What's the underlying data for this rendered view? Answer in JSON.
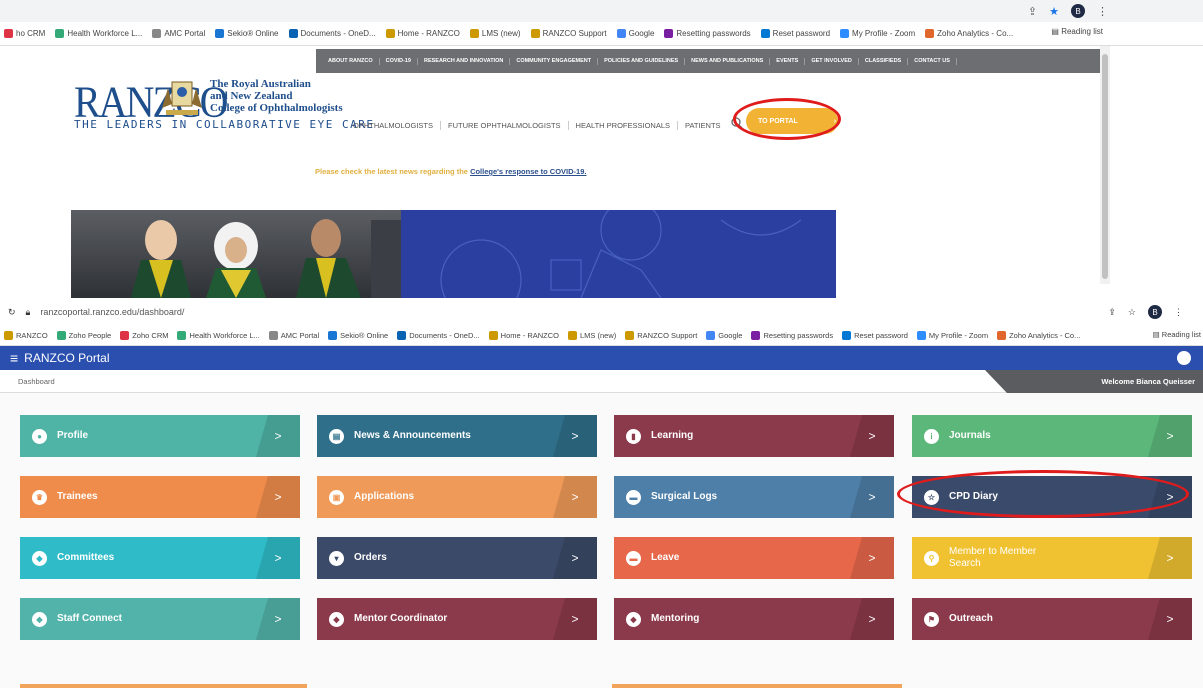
{
  "top": {
    "bookmarks": [
      {
        "label": "ho CRM",
        "color": "#d34"
      },
      {
        "label": "Health Workforce L...",
        "color": "#3a7"
      },
      {
        "label": "AMC Portal",
        "color": "#888"
      },
      {
        "label": "Sekio® Online",
        "color": "#1976d2"
      },
      {
        "label": "Documents - OneD...",
        "color": "#0a62b3"
      },
      {
        "label": "Home - RANZCO",
        "color": "#c90"
      },
      {
        "label": "LMS (new)",
        "color": "#c90"
      },
      {
        "label": "RANZCO Support",
        "color": "#c90"
      },
      {
        "label": "Google",
        "color": "#4285f4"
      },
      {
        "label": "Resetting passwords",
        "color": "#7b1fa2"
      },
      {
        "label": "Reset password",
        "color": "#0078d4"
      },
      {
        "label": "My Profile - Zoom",
        "color": "#2d8cff"
      },
      {
        "label": "Zoho Analytics - Co...",
        "color": "#e0662b"
      }
    ],
    "reading_list": "Reading list",
    "avatar": "B",
    "site_nav": [
      "ABOUT RANZCO",
      "COVID-19",
      "RESEARCH AND INNOVATION",
      "COMMUNITY ENGAGEMENT",
      "POLICIES AND GUIDELINES",
      "NEWS AND PUBLICATIONS",
      "EVENTS",
      "GET INVOLVED",
      "CLASSIFIEDS",
      "CONTACT US"
    ],
    "logo": "RANZCO",
    "college_name": [
      "The Royal Australian",
      "and New Zealand",
      "College of Ophthalmologists"
    ],
    "tagline": "THE LEADERS IN COLLABORATIVE EYE CARE",
    "main_nav": [
      "OPHTHALMOLOGISTS",
      "FUTURE OPHTHALMOLOGISTS",
      "HEALTH PROFESSIONALS",
      "PATIENTS"
    ],
    "portal_button": "TO PORTAL",
    "covid_prefix": "Please check the latest news regarding the ",
    "covid_link": "College's response to COVID-19."
  },
  "bottom": {
    "url": "ranzcoportal.ranzco.edu/dashboard/",
    "bookmarks": [
      {
        "label": "RANZCO",
        "color": "#c90"
      },
      {
        "label": "Zoho People",
        "color": "#3a7"
      },
      {
        "label": "Zoho CRM",
        "color": "#d34"
      },
      {
        "label": "Health Workforce L...",
        "color": "#3a7"
      },
      {
        "label": "AMC Portal",
        "color": "#888"
      },
      {
        "label": "Sekio® Online",
        "color": "#1976d2"
      },
      {
        "label": "Documents - OneD...",
        "color": "#0a62b3"
      },
      {
        "label": "Home - RANZCO",
        "color": "#c90"
      },
      {
        "label": "LMS (new)",
        "color": "#c90"
      },
      {
        "label": "RANZCO Support",
        "color": "#c90"
      },
      {
        "label": "Google",
        "color": "#4285f4"
      },
      {
        "label": "Resetting passwords",
        "color": "#7b1fa2"
      },
      {
        "label": "Reset password",
        "color": "#0078d4"
      },
      {
        "label": "My Profile - Zoom",
        "color": "#2d8cff"
      },
      {
        "label": "Zoho Analytics - Co...",
        "color": "#e0662b"
      }
    ],
    "reading_list": "Reading list",
    "portal_title": "RANZCO Portal",
    "breadcrumb": "Dashboard",
    "welcome": "Welcome Bianca Queisser",
    "arrow": ">",
    "tiles": [
      {
        "label": "Profile",
        "color": "#4fb3a6",
        "icon": "person-icon",
        "glyph": "●"
      },
      {
        "label": "News & Announcements",
        "color": "#2f6f8a",
        "icon": "newspaper-icon",
        "glyph": "▤"
      },
      {
        "label": "Learning",
        "color": "#8b3a4b",
        "icon": "book-icon",
        "glyph": "▮"
      },
      {
        "label": "Journals",
        "color": "#5cb87a",
        "icon": "info-icon",
        "glyph": "i"
      },
      {
        "label": "Trainees",
        "color": "#ef8c4c",
        "icon": "trophy-icon",
        "glyph": "♛"
      },
      {
        "label": "Applications",
        "color": "#ef9a58",
        "icon": "document-icon",
        "glyph": "▣"
      },
      {
        "label": "Surgical Logs",
        "color": "#4e7fa8",
        "icon": "card-icon",
        "glyph": "▬"
      },
      {
        "label": "CPD Diary",
        "color": "#3a4a6b",
        "icon": "star-icon",
        "glyph": "☆"
      },
      {
        "label": "Committees",
        "color": "#2fbcc8",
        "icon": "group-icon",
        "glyph": "◆"
      },
      {
        "label": "Orders",
        "color": "#3b4a68",
        "icon": "cart-icon",
        "glyph": "▾"
      },
      {
        "label": "Leave",
        "color": "#e6674a",
        "icon": "calendar-icon",
        "glyph": "▬"
      },
      {
        "label": "Member to Member Search",
        "color": "#f0c232",
        "icon": "search-icon",
        "glyph": "⚲"
      },
      {
        "label": "Staff Connect",
        "color": "#52b3aa",
        "icon": "group-icon",
        "glyph": "◆"
      },
      {
        "label": "Mentor Coordinator",
        "color": "#8b3a4b",
        "icon": "group-icon",
        "glyph": "◆"
      },
      {
        "label": "Mentoring",
        "color": "#8b3a4b",
        "icon": "group-icon",
        "glyph": "◆"
      },
      {
        "label": "Outreach",
        "color": "#8b3a4b",
        "icon": "location-icon",
        "glyph": "⚑"
      }
    ]
  },
  "accent_red": "#e01b1b"
}
